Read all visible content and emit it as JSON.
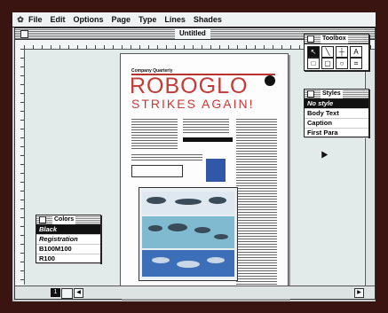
{
  "menubar": {
    "apple": "✿",
    "items": [
      "File",
      "Edit",
      "Options",
      "Page",
      "Type",
      "Lines",
      "Shades"
    ]
  },
  "window": {
    "title": "Untitled"
  },
  "page_content": {
    "kicker": "Company Quarterly",
    "headline1": "ROBOGLO",
    "headline2": "STRIKES AGAIN!"
  },
  "toolbox": {
    "title": "Toolbox",
    "tools": [
      "↖",
      "╲",
      "┼",
      "A",
      "□",
      "▢",
      "○",
      "⌗"
    ]
  },
  "styles": {
    "title": "Styles",
    "items": [
      "No style",
      "Body Text",
      "Caption",
      "First Para"
    ]
  },
  "colors": {
    "title": "Colors",
    "items": [
      "Black",
      "Registration",
      "B100M100",
      "R100"
    ]
  },
  "footer": {
    "page_number": "1"
  },
  "icons": [
    "close-box-icon",
    "arrow-cursor-icon",
    "scroll-arrow-icon",
    "page-icon"
  ],
  "accent_colors": {
    "headline_red": "#c63a36",
    "figure_blue": "#3158a8"
  }
}
